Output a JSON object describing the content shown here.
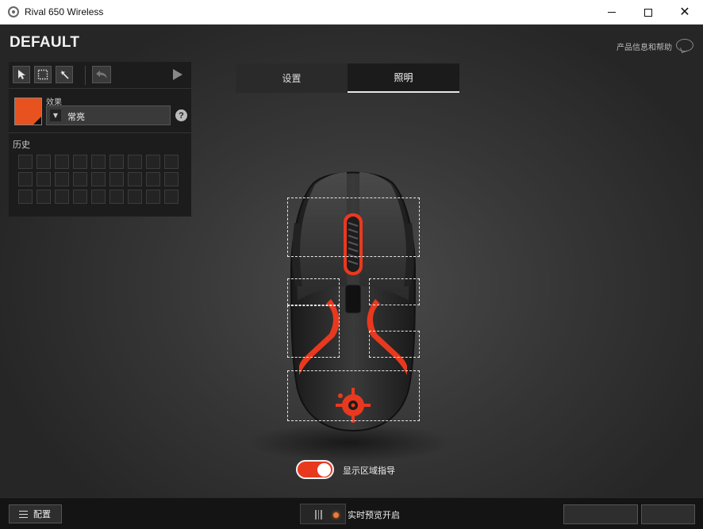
{
  "window": {
    "title": "Rival 650 Wireless",
    "minimize_glyph": "minimize-icon",
    "maximize_glyph": "maximize-icon",
    "close_glyph": "✕"
  },
  "header": {
    "preset_name": "DEFAULT",
    "help_link": "产品信息和帮助"
  },
  "left_panel": {
    "tools": [
      "pointer-tool-icon",
      "marquee-tool-icon",
      "magic-wand-tool-icon",
      "undo-icon",
      "play-icon"
    ],
    "swatch_color": "#e8521f",
    "effect_label": "效果",
    "effect_value": "常亮",
    "help_glyph": "?",
    "history_label": "历史",
    "history_cells": 27
  },
  "tabs": [
    {
      "label": "设置",
      "active": false
    },
    {
      "label": "照明",
      "active": true
    }
  ],
  "main": {
    "toggle_on": true,
    "toggle_label": "显示区域指导",
    "accent_color": "#e8391f"
  },
  "bottom": {
    "config_label": "配置",
    "preview_label": "实时预览开启"
  }
}
